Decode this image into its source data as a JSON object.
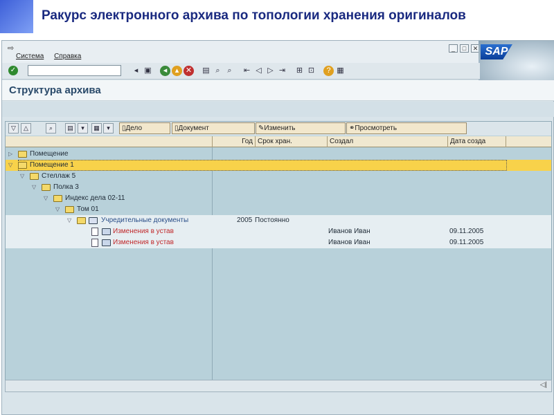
{
  "slide": {
    "title": "Ракурс электронного архива по топологии хранения оригиналов"
  },
  "menu": {
    "items": [
      "Система",
      "Справка"
    ]
  },
  "screen": {
    "title": "Структура архива"
  },
  "tree_toolbar": {
    "delo": "Дело",
    "dokument": "Документ",
    "izmenit": "Изменить",
    "prosmotret": "Просмотреть"
  },
  "columns": [
    "Год",
    "Срок хран.",
    "Создал",
    "Дата созда"
  ],
  "rows": [
    {
      "label": "Помещение",
      "indent": 0,
      "twisty": "collapsed",
      "icon": "folder"
    },
    {
      "label": "Помещение 1",
      "indent": 0,
      "twisty": "expanded",
      "icon": "folder",
      "selected": true
    },
    {
      "label": "Стеллаж 5",
      "indent": 1,
      "twisty": "expanded",
      "icon": "folder"
    },
    {
      "label": "Полка 3",
      "indent": 2,
      "twisty": "expanded",
      "icon": "folder"
    },
    {
      "label": "Индекс дела 02-11",
      "indent": 3,
      "twisty": "expanded",
      "icon": "folder"
    },
    {
      "label": "Том 01",
      "indent": 4,
      "twisty": "expanded",
      "icon": "folder"
    },
    {
      "label": "Учредительные документы",
      "indent": 5,
      "twisty": "expanded",
      "icon": "folder-open",
      "year": "2005",
      "term": "Постоянно"
    },
    {
      "label": "Изменения в устав",
      "indent": 6,
      "icon": "document",
      "creator": "Иванов Иван",
      "date": "09.11.2005"
    },
    {
      "label": "Изменения в устав",
      "indent": 6,
      "icon": "document",
      "creator": "Иванов Иван",
      "date": "09.11.2005"
    }
  ],
  "colors": {
    "selected": "#f8d24a",
    "tree_bg": "#b8d1da",
    "red_text": "#c0282a"
  }
}
